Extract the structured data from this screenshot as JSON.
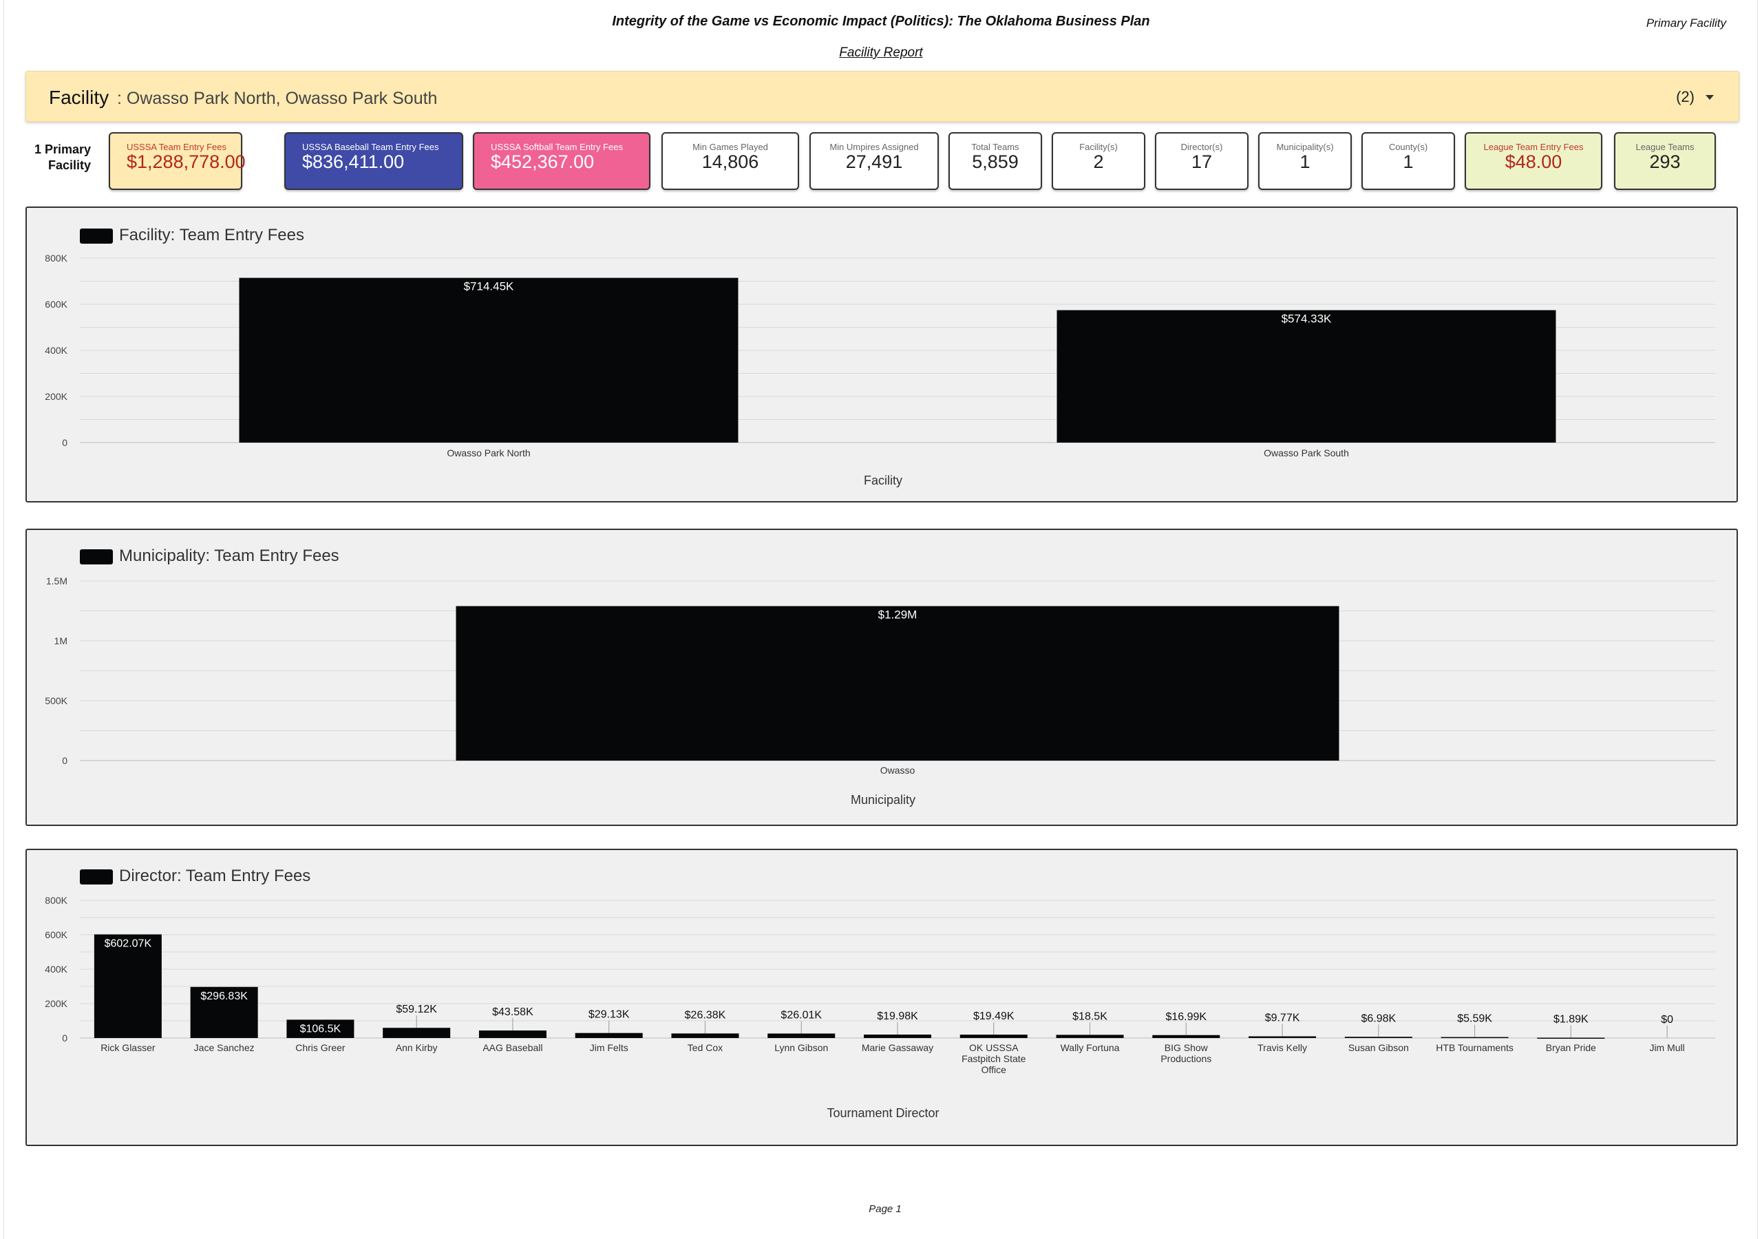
{
  "header": {
    "title": "Integrity of the Game vs Economic Impact (Politics): The Oklahoma Business Plan",
    "report_type": "Facility Report",
    "corner_label": "Primary Facility",
    "page": "Page 1"
  },
  "filter": {
    "label": "Facility",
    "value": ": Owasso Park North, Owasso Park South",
    "count": "(2)"
  },
  "primary_count": {
    "line1": "1 Primary",
    "line2": "Facility"
  },
  "kpis": [
    {
      "label": "USSSA Team Entry Fees",
      "value": "$1,288,778.00",
      "bg": "#feeab2",
      "label_color": "#c0392b",
      "value_color": "#b3261e"
    },
    {
      "label": "USSSA Baseball Team Entry Fees",
      "value": "$836,411.00",
      "bg": "#3f4ba6",
      "label_color": "#ffffff",
      "value_color": "#ffffff"
    },
    {
      "label": "USSSA Softball Team Entry Fees",
      "value": "$452,367.00",
      "bg": "#ef6293",
      "label_color": "#ffffff",
      "value_color": "#ffffff"
    },
    {
      "label": "Min Games Played",
      "value": "14,806",
      "bg": "#ffffff",
      "label_color": "#666666",
      "value_color": "#222222"
    },
    {
      "label": "Min Umpires Assigned",
      "value": "27,491",
      "bg": "#ffffff",
      "label_color": "#666666",
      "value_color": "#222222"
    },
    {
      "label": "Total Teams",
      "value": "5,859",
      "bg": "#ffffff",
      "label_color": "#666666",
      "value_color": "#222222"
    },
    {
      "label": "Facility(s)",
      "value": "2",
      "bg": "#ffffff",
      "label_color": "#666666",
      "value_color": "#222222"
    },
    {
      "label": "Director(s)",
      "value": "17",
      "bg": "#ffffff",
      "label_color": "#666666",
      "value_color": "#222222"
    },
    {
      "label": "Municipality(s)",
      "value": "1",
      "bg": "#ffffff",
      "label_color": "#666666",
      "value_color": "#222222"
    },
    {
      "label": "County(s)",
      "value": "1",
      "bg": "#ffffff",
      "label_color": "#666666",
      "value_color": "#222222"
    },
    {
      "label": "League Team Entry Fees",
      "value": "$48.00",
      "bg": "#eef3c7",
      "label_color": "#c0392b",
      "value_color": "#b3261e"
    },
    {
      "label": "League Teams",
      "value": "293",
      "bg": "#eef3c7",
      "label_color": "#666666",
      "value_color": "#222222"
    }
  ],
  "colors": {
    "bar": "#050708",
    "panel_bg": "#eff0ef",
    "accent_yellow": "#feeab2"
  },
  "chart_data": [
    {
      "type": "bar",
      "legend": "Facility: Team Entry Fees",
      "xlabel": "Facility",
      "ylabel": "",
      "categories": [
        "Owasso Park North",
        "Owasso Park South"
      ],
      "values": [
        714450,
        574330
      ],
      "value_labels": [
        "$714.45K",
        "$574.33K"
      ],
      "ylim": [
        0,
        800000
      ],
      "yticks": [
        0,
        200000,
        400000,
        600000,
        800000
      ],
      "ytick_labels": [
        "0",
        "200K",
        "400K",
        "600K",
        "800K"
      ],
      "grid": true,
      "legend_position": "top-left"
    },
    {
      "type": "bar",
      "legend": "Municipality: Team Entry Fees",
      "xlabel": "Municipality",
      "ylabel": "",
      "categories": [
        "Owasso"
      ],
      "values": [
        1290000
      ],
      "value_labels": [
        "$1.29M"
      ],
      "ylim": [
        0,
        1500000
      ],
      "yticks": [
        0,
        500000,
        1000000,
        1500000
      ],
      "ytick_labels": [
        "0",
        "500K",
        "1M",
        "1.5M"
      ],
      "grid": true,
      "legend_position": "top-left"
    },
    {
      "type": "bar",
      "legend": "Director: Team Entry Fees",
      "xlabel": "Tournament Director",
      "ylabel": "",
      "categories": [
        "Rick Glasser",
        "Jace Sanchez",
        "Chris Greer",
        "Ann Kirby",
        "AAG Baseball",
        "Jim Felts",
        "Ted Cox",
        "Lynn Gibson",
        "Marie Gassaway",
        "OK USSSA Fastpitch State Office",
        "Wally Fortuna",
        "BIG Show Productions",
        "Travis Kelly",
        "Susan Gibson",
        "HTB Tournaments",
        "Bryan Pride",
        "Jim Mull"
      ],
      "category_lines": [
        [
          "Rick Glasser"
        ],
        [
          "Jace Sanchez"
        ],
        [
          "Chris Greer"
        ],
        [
          "Ann Kirby"
        ],
        [
          "AAG Baseball"
        ],
        [
          "Jim Felts"
        ],
        [
          "Ted Cox"
        ],
        [
          "Lynn Gibson"
        ],
        [
          "Marie Gassaway"
        ],
        [
          "OK USSSA",
          "Fastpitch State",
          "Office"
        ],
        [
          "Wally Fortuna"
        ],
        [
          "BIG Show",
          "Productions"
        ],
        [
          "Travis Kelly"
        ],
        [
          "Susan Gibson"
        ],
        [
          "HTB Tournaments"
        ],
        [
          "Bryan Pride"
        ],
        [
          "Jim Mull"
        ]
      ],
      "values": [
        602070,
        296830,
        106500,
        59120,
        43580,
        29130,
        26380,
        26010,
        19980,
        19490,
        18500,
        16990,
        9770,
        6980,
        5590,
        1890,
        0
      ],
      "value_labels": [
        "$602.07K",
        "$296.83K",
        "$106.5K",
        "$59.12K",
        "$43.58K",
        "$29.13K",
        "$26.38K",
        "$26.01K",
        "$19.98K",
        "$19.49K",
        "$18.5K",
        "$16.99K",
        "$9.77K",
        "$6.98K",
        "$5.59K",
        "$1.89K",
        "$0"
      ],
      "ylim": [
        0,
        800000
      ],
      "yticks": [
        0,
        200000,
        400000,
        600000,
        800000
      ],
      "ytick_labels": [
        "0",
        "200K",
        "400K",
        "600K",
        "800K"
      ],
      "grid": true,
      "legend_position": "top-left"
    }
  ]
}
